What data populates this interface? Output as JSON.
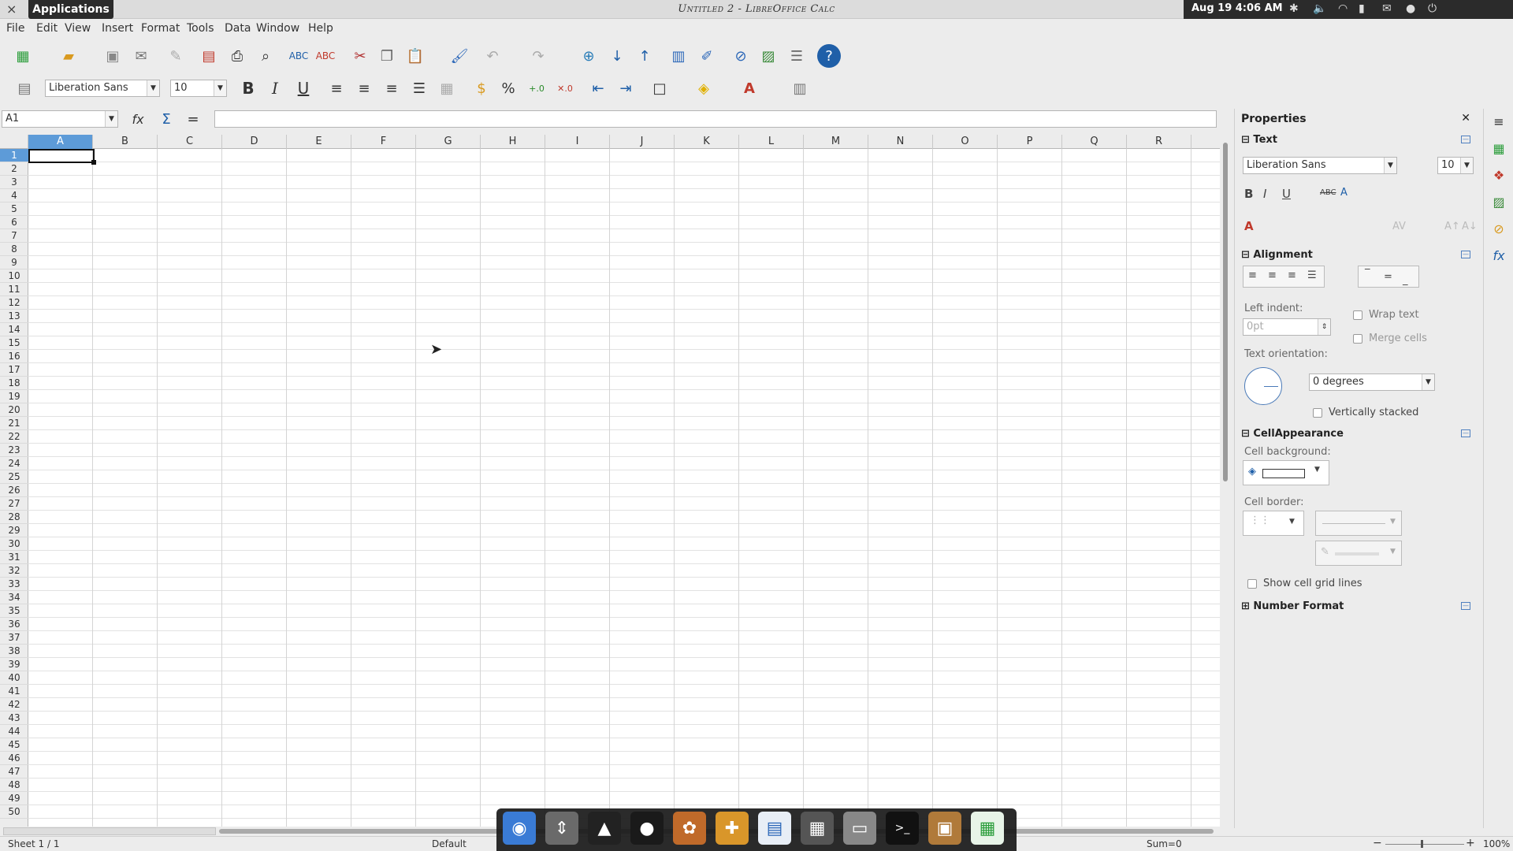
{
  "topbar": {
    "applications_label": "Applications",
    "window_title": "Untitled 2 - LibreOffice Calc",
    "clock": "Aug 19  4:06 AM"
  },
  "menu": [
    "File",
    "Edit",
    "View",
    "Insert",
    "Format",
    "Tools",
    "Data",
    "Window",
    "Help"
  ],
  "format_toolbar": {
    "font_name": "Liberation Sans",
    "font_size": "10"
  },
  "formula_bar": {
    "name_box": "A1",
    "formula_value": ""
  },
  "grid": {
    "columns": [
      "A",
      "B",
      "C",
      "D",
      "E",
      "F",
      "G",
      "H",
      "I",
      "J",
      "K",
      "L",
      "M",
      "N",
      "O",
      "P",
      "Q",
      "R"
    ],
    "rows": [
      "1",
      "2",
      "3",
      "4",
      "5",
      "6",
      "7",
      "8",
      "9",
      "10",
      "11",
      "12",
      "13",
      "14",
      "15",
      "16",
      "17",
      "18",
      "19",
      "20",
      "21",
      "22",
      "23",
      "24",
      "25",
      "26",
      "27",
      "28",
      "29",
      "30",
      "31",
      "32",
      "33",
      "34",
      "35",
      "36",
      "37",
      "38",
      "39",
      "40",
      "41",
      "42",
      "43",
      "44",
      "45",
      "46",
      "47",
      "48",
      "49",
      "50"
    ],
    "selected_column": "A",
    "selected_row": "1"
  },
  "sidebar": {
    "title": "Properties",
    "text_section": "Text",
    "font_name": "Liberation Sans",
    "font_size": "10",
    "alignment_section": "Alignment",
    "left_indent_label": "Left indent:",
    "left_indent_value": "0pt",
    "wrap_text": "Wrap text",
    "merge_cells": "Merge cells",
    "text_orientation_label": "Text orientation:",
    "orientation_value": "0 degrees",
    "vertically_stacked": "Vertically stacked",
    "cell_appearance_section": "CellAppearance",
    "cell_background_label": "Cell background:",
    "cell_border_label": "Cell border:",
    "show_grid_lines": "Show cell grid lines",
    "number_format_section": "Number Format"
  },
  "statusbar": {
    "sheet": "Sheet 1 / 1",
    "page_style": "Default",
    "sum": "Sum=0",
    "zoom": "100%"
  },
  "colors": {
    "selection_blue": "#5d9bd8",
    "dark_panel": "#2b2b2b"
  }
}
